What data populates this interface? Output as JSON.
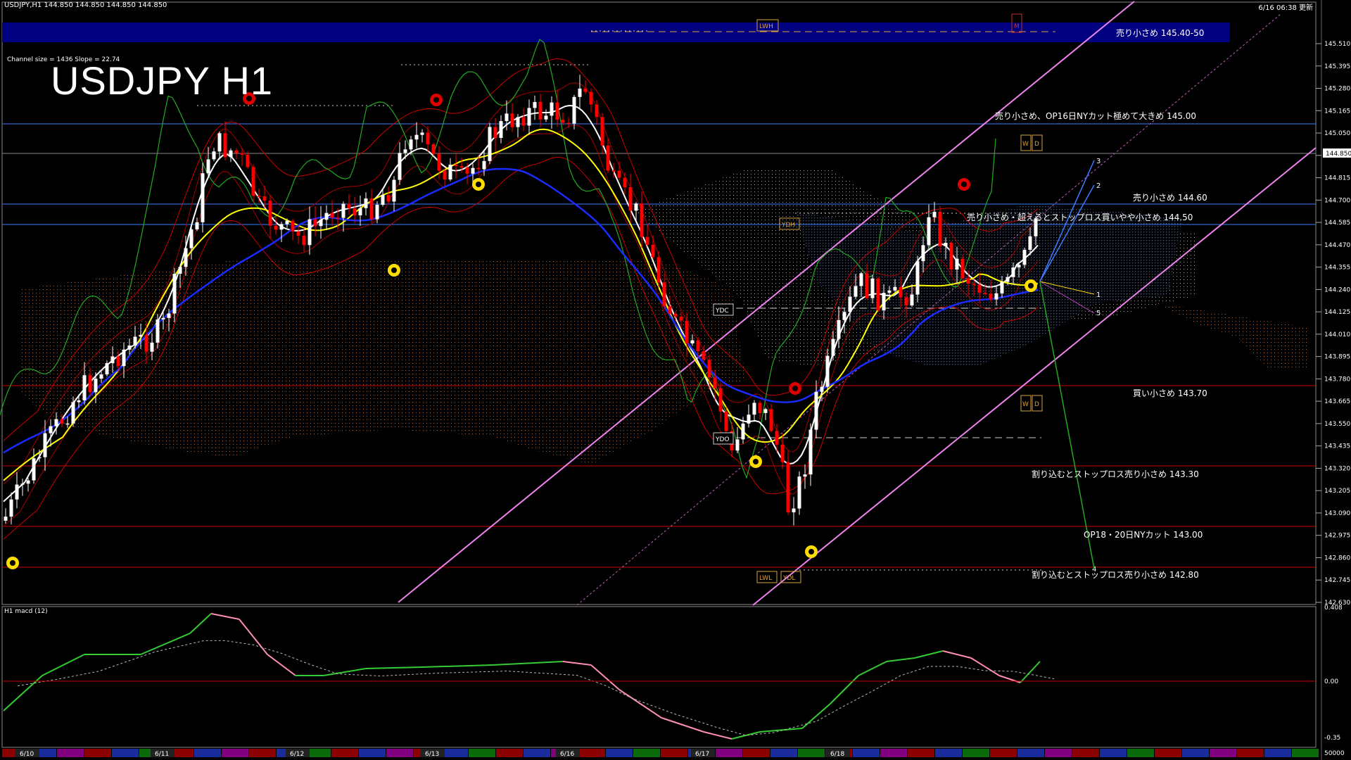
{
  "header": {
    "symbol_line": "USDJPY,H1  144.850 144.850 144.850 144.850",
    "clock": "6/16 06:38 更新",
    "channel_info": "Channel size = 1436 Slope = 22.74",
    "title": "USDJPY H1",
    "macd_label": "H1 macd (12)"
  },
  "price_axis": {
    "labels": [
      "145.510",
      "145.395",
      "145.280",
      "145.165",
      "145.050",
      "144.930",
      "144.815",
      "144.700",
      "144.585",
      "144.470",
      "144.355",
      "144.240",
      "144.125",
      "144.010",
      "143.895",
      "143.780",
      "143.665",
      "143.550",
      "143.435",
      "143.320",
      "143.205",
      "143.090",
      "142.975",
      "142.860",
      "142.745",
      "142.630"
    ],
    "current_price": "144.850",
    "macd_labels": [
      "0.408",
      "0.00",
      "-0.35",
      "50000"
    ]
  },
  "date_axis": {
    "labels": [
      "6/10",
      "6/11",
      "6/12",
      "6/13",
      "6/16",
      "6/17",
      "6/18"
    ]
  },
  "annotations": {
    "sell_145_40": "売り小さめ 145.40-50",
    "sell_145_00": "売り小さめ、OP16日NYカット極めて大きめ 145.00",
    "sell_144_60": "売り小さめ 144.60",
    "sell_144_50": "売り小さめ・超えるとストップロス買いやや小さめ 144.50",
    "buy_143_70": "買い小さめ 143.70",
    "stop_143_30": "割り込むとストップロス売り小さめ 143.30",
    "op_143_00": "OP18・20日NYカット 143.00",
    "stop_142_80": "割り込むとストップロス売り小さめ 142.80"
  },
  "markers": {
    "lwh": "LWH",
    "lwl": "LWL",
    "ydh": "YDH",
    "ydc": "YDC",
    "ydo": "YDO",
    "ydl": "YDL",
    "w": "W",
    "d": "D",
    "m": "M",
    "n1": "1",
    "n2": "2",
    "n3": "3",
    "n4": "4",
    "n5": "5"
  },
  "colors": {
    "background": "#000000",
    "bull_candle": "#ffffff",
    "bear_candle": "#ff0000",
    "sell_band": "#000080",
    "ma_white": "#ffffff",
    "ma_yellow": "#ffff00",
    "ma_blue": "#1a2bff",
    "channel": "#ee82ee",
    "macd_up": "#33cc33",
    "macd_down": "#ff8fb0"
  }
}
